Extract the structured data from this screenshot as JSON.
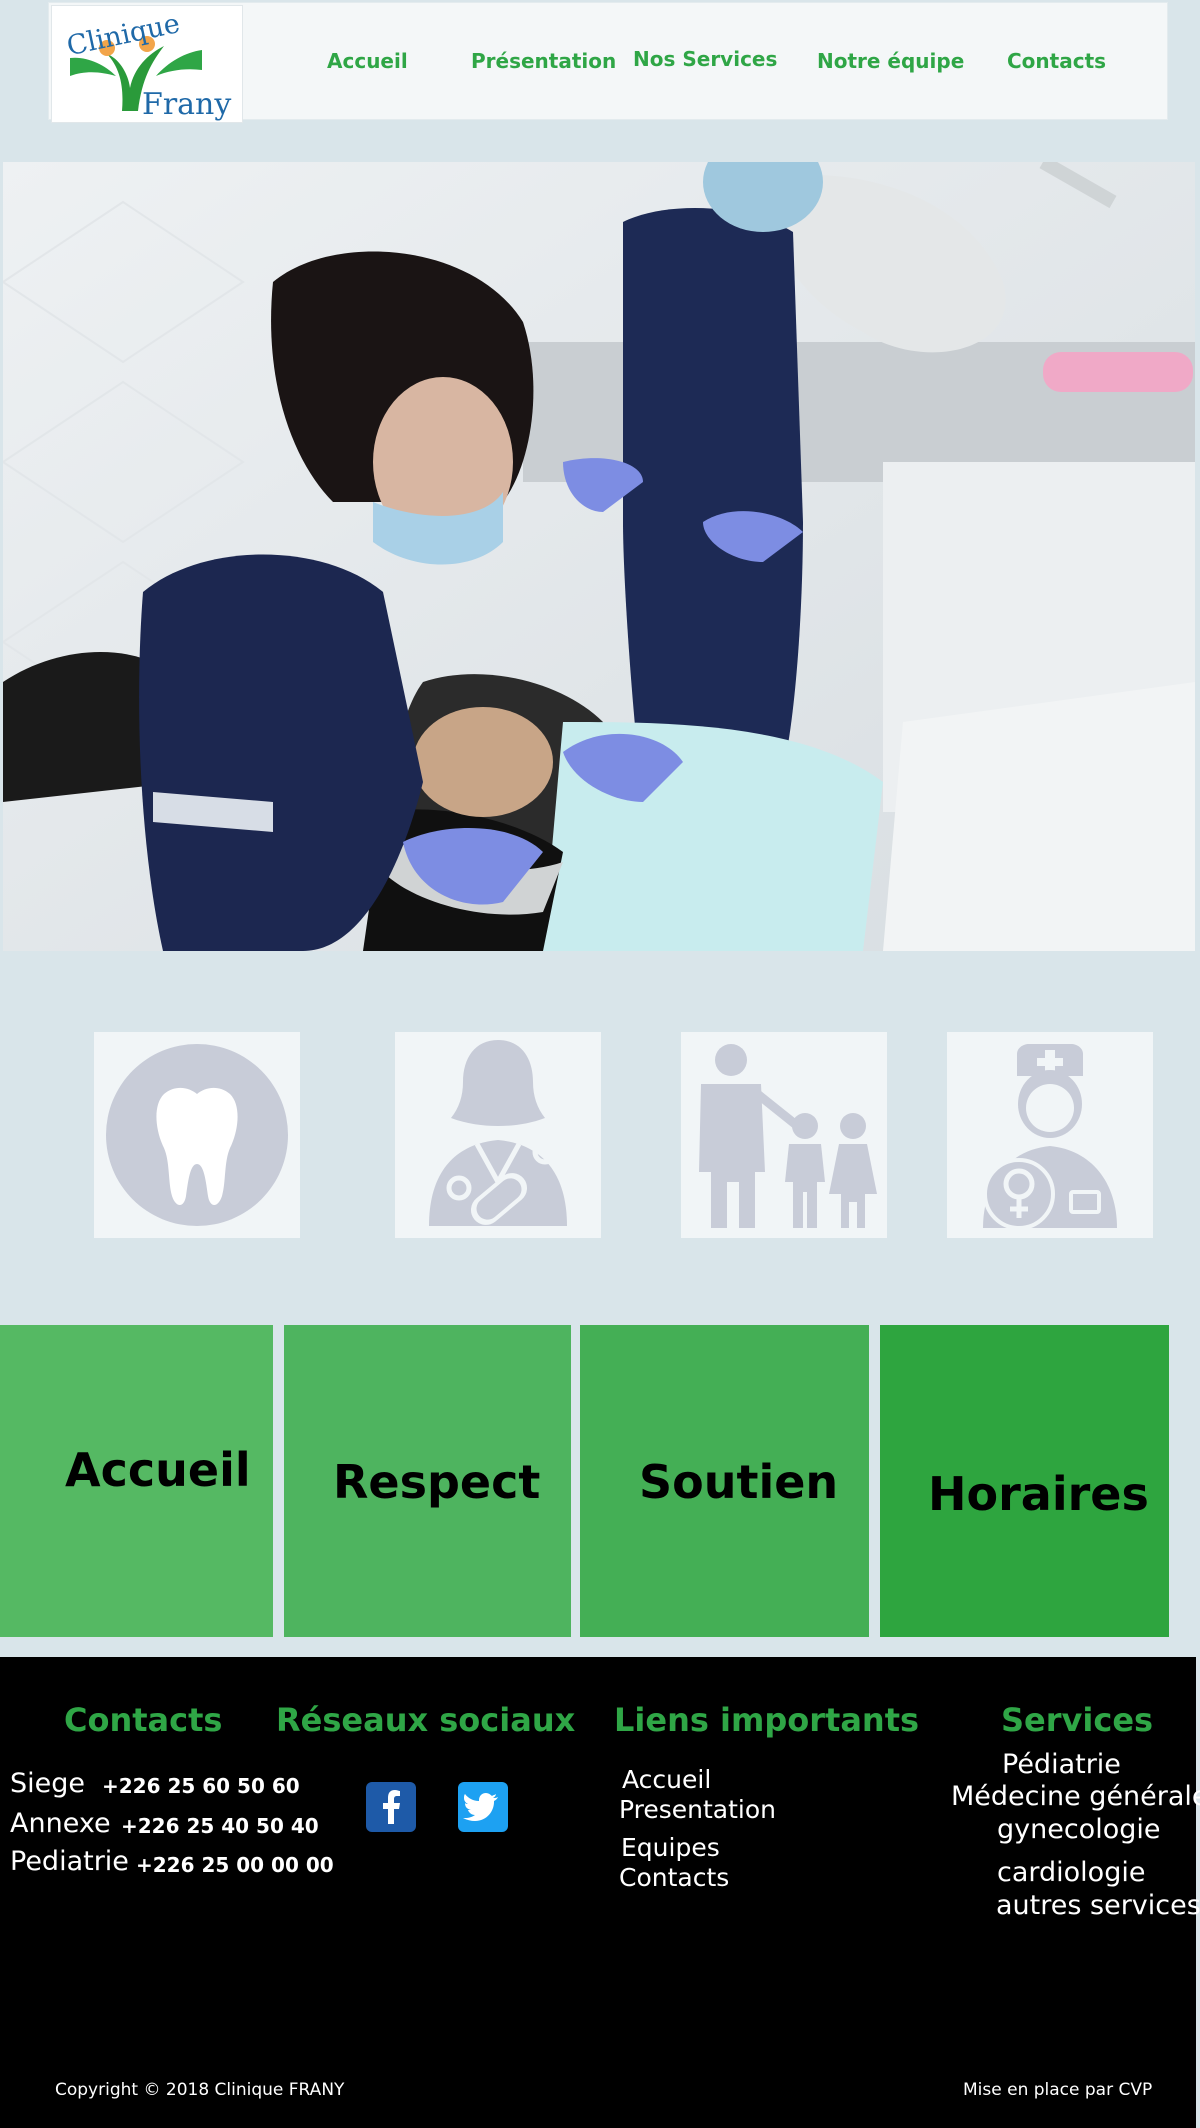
{
  "brand": {
    "logo_line1": "Clinique",
    "logo_line2": "Frany"
  },
  "nav": {
    "items": [
      "Accueil",
      "Présentation",
      "Nos Services",
      "Notre équipe",
      "Contacts"
    ]
  },
  "services_icons": [
    "tooth-icon",
    "female-doctor-icon",
    "pediatrics-family-icon",
    "gynecologist-icon"
  ],
  "values": [
    {
      "label": "Accueil",
      "color": "#55b963"
    },
    {
      "label": "Respect",
      "color": "#4eb45f"
    },
    {
      "label": "Soutien",
      "color": "#44af55"
    },
    {
      "label": "Horaires",
      "color": "#2ea53f"
    }
  ],
  "footer": {
    "contacts": {
      "heading": "Contacts",
      "sites": [
        {
          "name": "Siege",
          "phone": "+226 25 60 50 60"
        },
        {
          "name": "Annexe",
          "phone": "+226 25 40 50 40"
        },
        {
          "name": "Pediatrie",
          "phone": "+226 25 00 00 00"
        }
      ]
    },
    "social": {
      "heading": "Réseaux sociaux",
      "icons": [
        "facebook-icon",
        "twitter-icon"
      ],
      "colors": {
        "facebook": "#1e5aa8",
        "twitter": "#1da1f2"
      }
    },
    "links": {
      "heading": "Liens importants",
      "items": [
        "Accueil",
        "Presentation",
        "Equipes",
        "Contacts"
      ]
    },
    "services": {
      "heading": "Services",
      "items": [
        "Pédiatrie",
        "Médecine générale",
        "gynecologie",
        "cardiologie",
        "autres services"
      ]
    },
    "copyright": "Copyright © 2018 Clinique FRANY",
    "credit": "Mise en place par CVP"
  },
  "colors": {
    "accent_green": "#2fa646",
    "page_bg": "#d9e5ea",
    "footer_bg": "#000000"
  }
}
